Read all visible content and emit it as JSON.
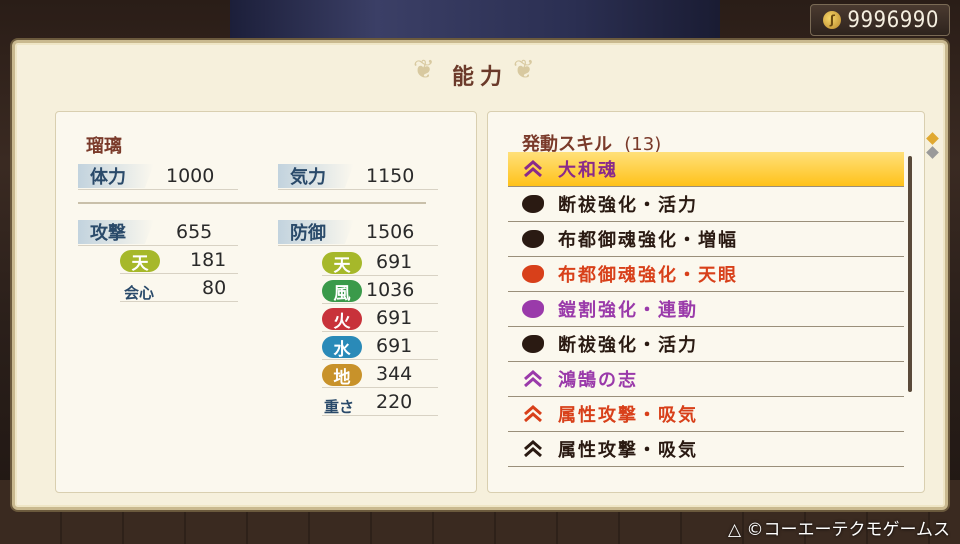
{
  "currency": {
    "amount": "9996990",
    "icon": "coin-icon"
  },
  "panel": {
    "title": "能力"
  },
  "character": {
    "name": "瑠璃"
  },
  "stats": {
    "hp": {
      "label": "体力",
      "value": "1000"
    },
    "ki": {
      "label": "気力",
      "value": "1150"
    },
    "attack": {
      "label": "攻撃",
      "value": "655"
    },
    "defense": {
      "label": "防御",
      "value": "1506"
    },
    "attack_elem": {
      "label": "天",
      "value": "181"
    },
    "crit": {
      "label": "会心",
      "value": "80"
    },
    "def_elems": [
      {
        "label": "天",
        "value": "691",
        "color": "#a6b82a"
      },
      {
        "label": "風",
        "value": "1036",
        "color": "#3a9a4a"
      },
      {
        "label": "火",
        "value": "691",
        "color": "#c8323a"
      },
      {
        "label": "水",
        "value": "691",
        "color": "#2a8ab8"
      },
      {
        "label": "地",
        "value": "344",
        "color": "#c8922a"
      }
    ],
    "weight": {
      "label": "重さ",
      "value": "220"
    }
  },
  "skills": {
    "header": "発動スキル",
    "count": "(13)",
    "items": [
      {
        "label": "大和魂",
        "color": "#8a2a8a",
        "icon": "chevron-up-icon",
        "selected": true
      },
      {
        "label": "断祓強化・活力",
        "color": "#2a1a12",
        "icon": "blob-icon"
      },
      {
        "label": "布都御魂強化・増幅",
        "color": "#2a1a12",
        "icon": "blob-icon"
      },
      {
        "label": "布都御魂強化・天眼",
        "color": "#d8401a",
        "icon": "blob-icon"
      },
      {
        "label": "鎧割強化・連動",
        "color": "#9a3aaa",
        "icon": "blob-icon"
      },
      {
        "label": "断祓強化・活力",
        "color": "#2a1a12",
        "icon": "blob-icon"
      },
      {
        "label": "鴻鵠の志",
        "color": "#9a3aaa",
        "icon": "chevron-up-icon"
      },
      {
        "label": "属性攻撃・吸気",
        "color": "#d8401a",
        "icon": "chevron-up-icon"
      },
      {
        "label": "属性攻撃・吸気",
        "color": "#2a1a12",
        "icon": "chevron-up-icon"
      }
    ]
  },
  "footer": {
    "copyright": "△ ©コーエーテクモゲームス"
  }
}
